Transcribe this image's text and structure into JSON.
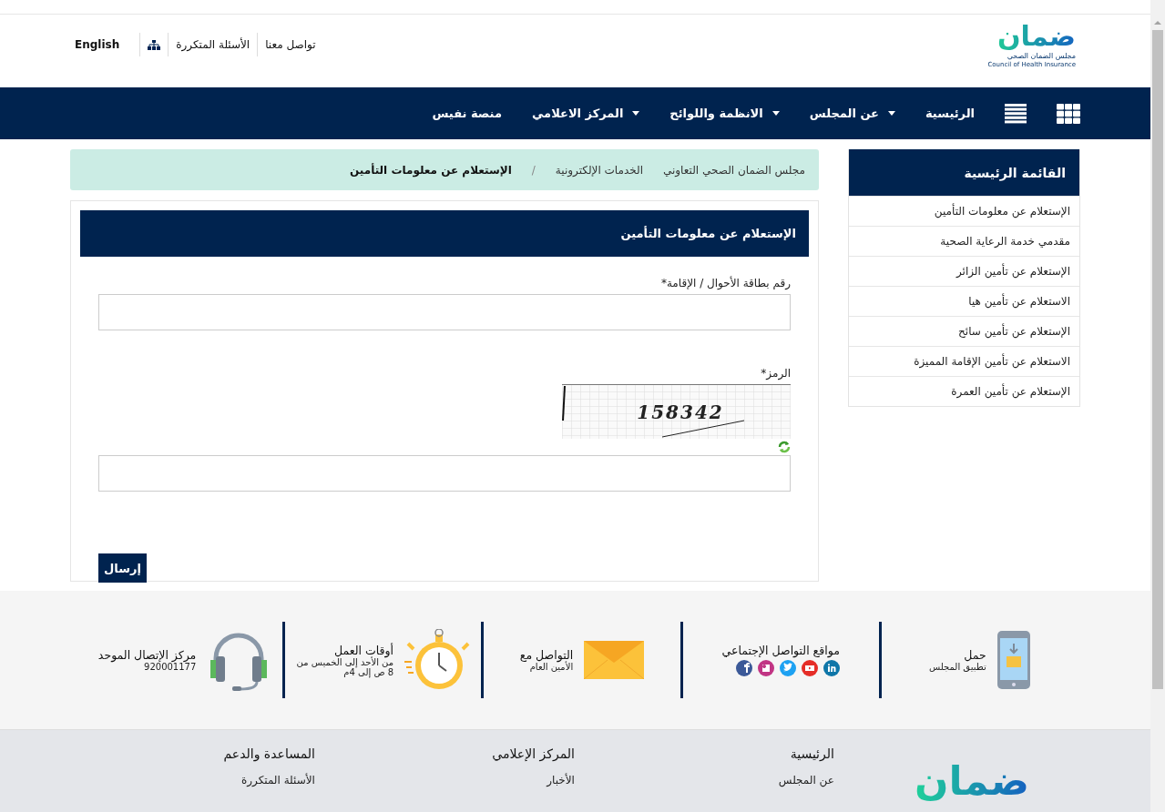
{
  "header": {
    "logo": {
      "wordmark": "ضمان",
      "arabic_name": "مجلس الضمان الصحي",
      "english_name": "Council of Health Insurance"
    },
    "links": [
      {
        "kind": "text",
        "label": "تواصل معنا"
      },
      {
        "kind": "text",
        "label": "الأسئلة المتكررة"
      },
      {
        "kind": "sitemap"
      },
      {
        "kind": "language",
        "label": "English"
      }
    ]
  },
  "nav": {
    "items": [
      {
        "label": "الرئيسية",
        "dropdown": false
      },
      {
        "label": "عن المجلس",
        "dropdown": true
      },
      {
        "label": "الانظمة واللوائح",
        "dropdown": true
      },
      {
        "label": "المركز الاعلامي",
        "dropdown": true
      },
      {
        "label": "منصة نفيس",
        "dropdown": false
      }
    ]
  },
  "sidebar": {
    "title": "القائمة الرئيسية",
    "items": [
      "الإستعلام عن معلومات التأمين",
      "مقدمي خدمة الرعاية الصحية",
      "الإستعلام عن تأمين الزائر",
      "الاستعلام عن تأمين هيا",
      "الإستعلام عن تأمين سائح",
      "الاستعلام عن تأمين الإقامة المميزة",
      "الإستعلام عن تأمين العمرة"
    ]
  },
  "breadcrumb": {
    "separator": "/",
    "items": [
      {
        "label": "مجلس الضمان الصحي التعاوني",
        "current": false
      },
      {
        "label": "الخدمات الإلكترونية",
        "current": false
      },
      {
        "label": "الإستعلام عن معلومات التأمين",
        "current": true
      }
    ]
  },
  "form": {
    "title": "الإستعلام عن معلومات التأمين",
    "fields": [
      {
        "kind": "text",
        "label": "رقم بطاقة الأحوال / الإقامة*"
      },
      {
        "kind": "captcha",
        "label": "الرمز*",
        "captcha": "158342"
      }
    ],
    "submit": "إرسال"
  },
  "contact_strip": [
    {
      "kind": "app",
      "title": "حمل",
      "lines": [
        "تطبيق المجلس"
      ]
    },
    {
      "kind": "social",
      "title": "مواقع التواصل الإجتماعي"
    },
    {
      "kind": "mail",
      "title": "التواصل مع",
      "lines": [
        "الأمين العام"
      ]
    },
    {
      "kind": "clock",
      "title": "أوقات العمل",
      "lines": [
        "من الأحد إلى الخميس من",
        "8 ص إلى 4م"
      ]
    },
    {
      "kind": "headset",
      "title": "مركز الإتصال الموحد",
      "lines": [
        "920001177"
      ]
    }
  ],
  "footer": {
    "logo": "ضمان",
    "columns": [
      {
        "title": "الرئيسية",
        "links": [
          "عن المجلس"
        ]
      },
      {
        "title": "المركز الإعلامي",
        "links": [
          "الأخبار"
        ]
      },
      {
        "title": "المساعدة والدعم",
        "links": [
          "الأسئلة المتكررة"
        ]
      }
    ]
  }
}
